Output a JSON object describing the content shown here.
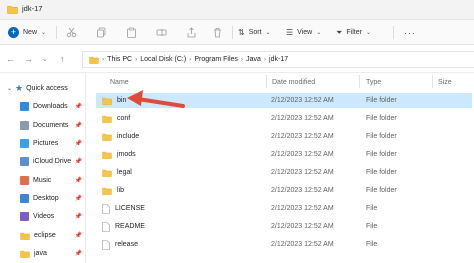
{
  "window": {
    "title": "jdk-17"
  },
  "toolbar": {
    "new_label": "New",
    "sort_label": "Sort",
    "view_label": "View",
    "filter_label": "Filter"
  },
  "address": {
    "crumbs": [
      "This PC",
      "Local Disk (C:)",
      "Program Files",
      "Java",
      "jdk-17"
    ]
  },
  "sidebar": {
    "quick_access_label": "Quick access",
    "items": [
      {
        "label": "Downloads",
        "icon": "downloads-icon"
      },
      {
        "label": "Documents",
        "icon": "documents-icon"
      },
      {
        "label": "Pictures",
        "icon": "pictures-icon"
      },
      {
        "label": "iCloud Drive",
        "icon": "icloud-drive-icon"
      },
      {
        "label": "Music",
        "icon": "music-icon"
      },
      {
        "label": "Desktop",
        "icon": "desktop-icon"
      },
      {
        "label": "Videos",
        "icon": "videos-icon"
      },
      {
        "label": "eclipse",
        "icon": "folder-icon"
      },
      {
        "label": "java",
        "icon": "folder-icon"
      }
    ]
  },
  "columns": {
    "name": "Name",
    "date": "Date modified",
    "type": "Type",
    "size": "Size"
  },
  "files": [
    {
      "name": "bin",
      "date": "2/12/2023 12:52 AM",
      "type": "File folder",
      "kind": "folder",
      "selected": true
    },
    {
      "name": "conf",
      "date": "2/12/2023 12:52 AM",
      "type": "File folder",
      "kind": "folder"
    },
    {
      "name": "include",
      "date": "2/12/2023 12:52 AM",
      "type": "File folder",
      "kind": "folder"
    },
    {
      "name": "jmods",
      "date": "2/12/2023 12:52 AM",
      "type": "File folder",
      "kind": "folder"
    },
    {
      "name": "legal",
      "date": "2/12/2023 12:52 AM",
      "type": "File folder",
      "kind": "folder"
    },
    {
      "name": "lib",
      "date": "2/12/2023 12:52 AM",
      "type": "File folder",
      "kind": "folder"
    },
    {
      "name": "LICENSE",
      "date": "2/12/2023 12:52 AM",
      "type": "File",
      "kind": "file"
    },
    {
      "name": "README",
      "date": "2/12/2023 12:52 AM",
      "type": "File",
      "kind": "file"
    },
    {
      "name": "release",
      "date": "2/12/2023 12:52 AM",
      "type": "File",
      "kind": "file"
    }
  ],
  "colors": {
    "selection": "#cce8ff",
    "folder": "#f6c543",
    "annotation_arrow": "#e04a3a",
    "accent": "#0067c0"
  }
}
